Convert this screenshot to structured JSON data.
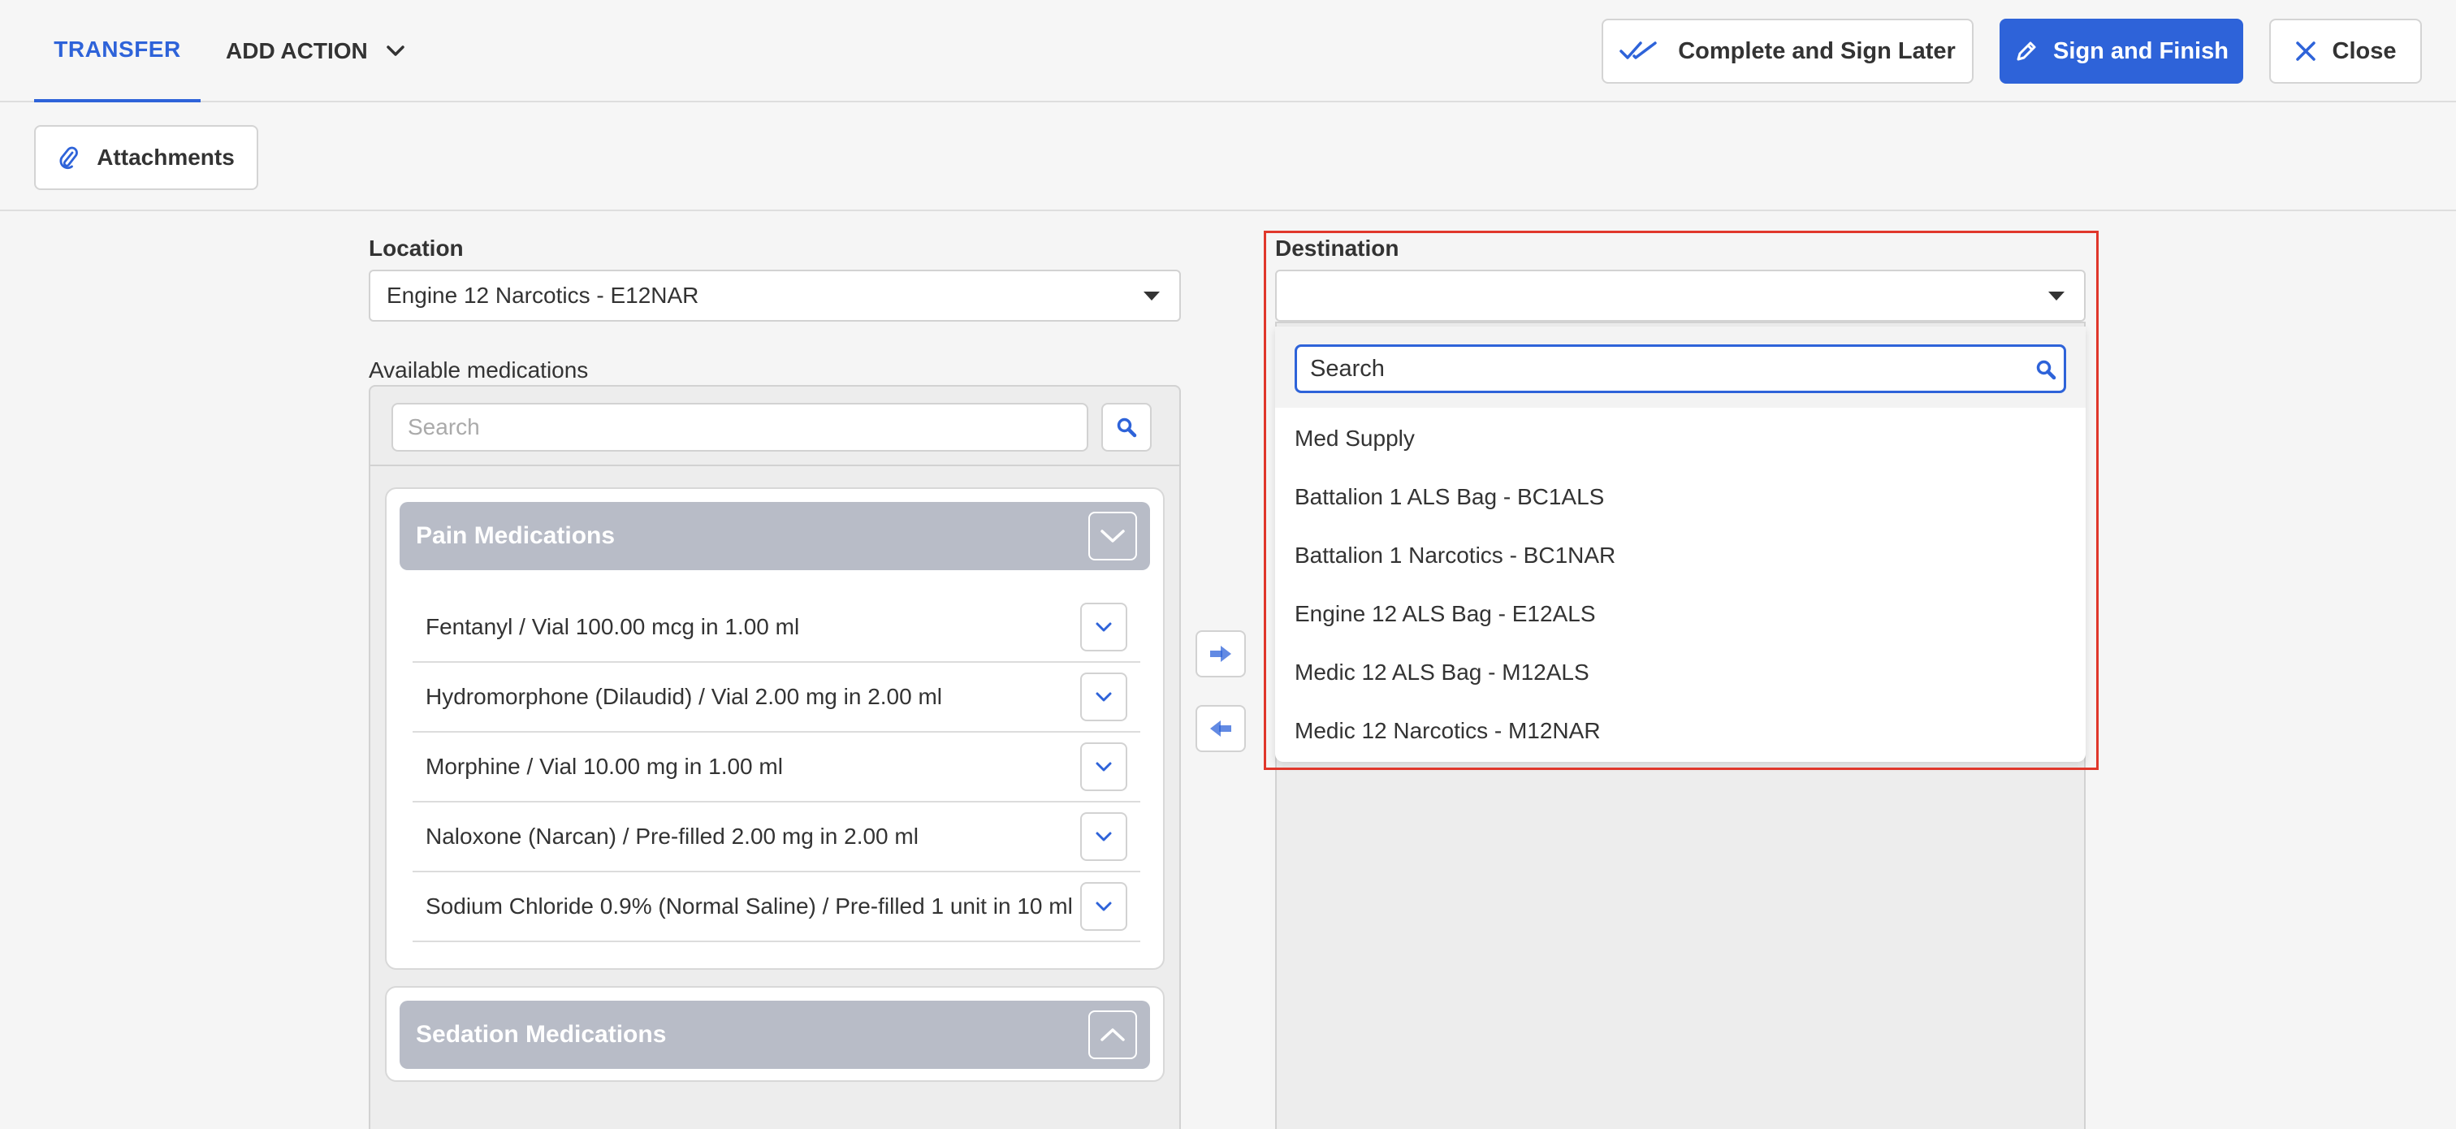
{
  "topbar": {
    "tab_transfer": "TRANSFER",
    "tab_add_action": "ADD ACTION",
    "complete_sign_later": "Complete and Sign Later",
    "sign_and_finish": "Sign and Finish",
    "close": "Close"
  },
  "toolbar": {
    "attachments": "Attachments"
  },
  "location": {
    "label": "Location",
    "value": "Engine 12 Narcotics - E12NAR"
  },
  "available": {
    "label": "Available medications",
    "search_placeholder": "Search",
    "groups": [
      {
        "title": "Pain Medications",
        "expanded": true,
        "items": [
          "Fentanyl / Vial 100.00 mcg in 1.00 ml",
          "Hydromorphone (Dilaudid) / Vial 2.00 mg in 2.00 ml",
          "Morphine / Vial 10.00 mg in 1.00 ml",
          "Naloxone (Narcan) / Pre-filled 2.00 mg in 2.00 ml",
          "Sodium Chloride 0.9% (Normal Saline) / Pre-filled 1 unit in 10 ml"
        ]
      },
      {
        "title": "Sedation Medications",
        "expanded": false,
        "items": []
      }
    ]
  },
  "destination": {
    "label": "Destination",
    "value": "",
    "search_placeholder": "Search",
    "options": [
      "Med Supply",
      "Battalion 1 ALS Bag - BC1ALS",
      "Battalion 1 Narcotics - BC1NAR",
      "Engine 12 ALS Bag - E12ALS",
      "Medic 12 ALS Bag - M12ALS",
      "Medic 12 Narcotics - M12NAR"
    ]
  },
  "colors": {
    "accent": "#2e63d9",
    "highlight": "#e0372b",
    "group_header": "#b8bcc7"
  }
}
